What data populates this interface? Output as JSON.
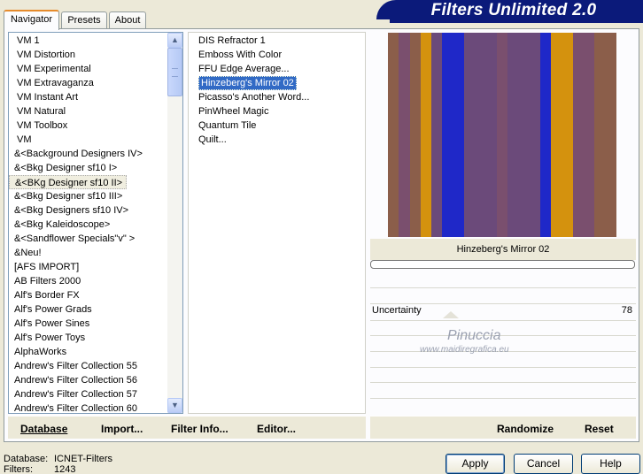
{
  "tabs": [
    "Navigator",
    "Presets",
    "About"
  ],
  "app_title": "Filters Unlimited 2.0",
  "categories": [
    "VM 1",
    "VM Distortion",
    "VM Experimental",
    "VM Extravaganza",
    "VM Instant Art",
    "VM Natural",
    "VM Toolbox",
    "VM",
    "&<Background Designers IV>",
    "&<Bkg Designer sf10 I>",
    "&<BKg Designer sf10 II>",
    "&<Bkg Designer sf10 III>",
    "&<Bkg Designers sf10 IV>",
    "&<Bkg Kaleidoscope>",
    "&<Sandflower Specials\"v\" >",
    "&Neu!",
    "[AFS IMPORT]",
    "AB Filters 2000",
    "Alf's Border FX",
    "Alf's Power Grads",
    "Alf's Power Sines",
    "Alf's Power Toys",
    "AlphaWorks",
    "Andrew's Filter Collection 55",
    "Andrew's Filter Collection 56",
    "Andrew's Filter Collection 57",
    "Andrew's Filter Collection 60"
  ],
  "selected_category": "&<BKg Designer sf10 II>",
  "filters": [
    "DIS Refractor 1",
    "Emboss With Color",
    "FFU Edge Average...",
    "Hinzeberg's Mirror 02",
    "Picasso's Another Word...",
    "PinWheel Magic",
    "Quantum Tile",
    "Quilt..."
  ],
  "selected_filter": "Hinzeberg's Mirror 02",
  "preview_filter_name": "Hinzeberg's Mirror 02",
  "preview_colors": {
    "brown": "#8b5e4a",
    "purple": "#6b4a7a",
    "blue": "#1f28c8",
    "gold": "#d4920e",
    "mauve": "#7a4f6e"
  },
  "preview_stripes": [
    "brown",
    "mauve",
    "brown",
    "gold",
    "purple",
    "blue",
    "blue",
    "purple",
    "purple",
    "purple",
    "mauve",
    "purple",
    "purple",
    "purple",
    "blue",
    "gold",
    "gold",
    "mauve",
    "mauve",
    "brown",
    "brown"
  ],
  "parameter": {
    "label": "Uncertainty",
    "value": "78"
  },
  "watermark": {
    "line1": "Pinuccia",
    "line2": "www.maidiregrafica.eu"
  },
  "bottom_links": [
    "Database",
    "Import...",
    "Filter Info...",
    "Editor..."
  ],
  "preview_actions": [
    "Randomize",
    "Reset"
  ],
  "status": {
    "database_label": "Database:",
    "database_value": "ICNET-Filters",
    "filters_label": "Filters:",
    "filters_value": "1243"
  },
  "buttons": {
    "apply": "Apply",
    "cancel": "Cancel",
    "help": "Help"
  }
}
